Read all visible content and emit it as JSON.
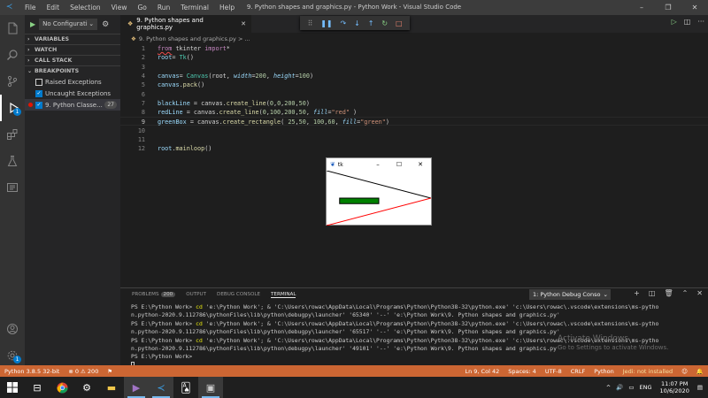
{
  "titlebar": {
    "menu": [
      "File",
      "Edit",
      "Selection",
      "View",
      "Go",
      "Run",
      "Terminal",
      "Help"
    ],
    "title": "9. Python shapes and graphics.py - Python Work - Visual Studio Code",
    "minimize": "–",
    "maximize": "❐",
    "close": "✕"
  },
  "sidebar": {
    "config_label": "No Configurati",
    "sections": [
      "VARIABLES",
      "WATCH",
      "CALL STACK",
      "BREAKPOINTS"
    ],
    "breakpoints": [
      {
        "label": "Raised Exceptions",
        "checked": false
      },
      {
        "label": "Uncaught Exceptions",
        "checked": true
      },
      {
        "label": "9. Python Classe...",
        "checked": true,
        "count": "27"
      }
    ]
  },
  "editor": {
    "tab_label": "9. Python shapes and graphics.py",
    "breadcrumb": "9. Python shapes and graphics.py > ...",
    "lines": [
      {
        "n": "1",
        "segs": [
          [
            "k squig",
            "from"
          ],
          [
            "d",
            " "
          ],
          [
            "d",
            "tkinter "
          ],
          [
            "k",
            "import"
          ],
          [
            "d",
            "*"
          ]
        ]
      },
      {
        "n": "2",
        "segs": [
          [
            "v",
            "root"
          ],
          [
            "d",
            "= "
          ],
          [
            "c",
            "Tk"
          ],
          [
            "d",
            "()"
          ]
        ]
      },
      {
        "n": "3",
        "segs": []
      },
      {
        "n": "4",
        "segs": [
          [
            "v",
            "canvas"
          ],
          [
            "d",
            "= "
          ],
          [
            "c",
            "Canvas"
          ],
          [
            "d",
            "(root, "
          ],
          [
            "p",
            "width"
          ],
          [
            "d",
            "="
          ],
          [
            "n",
            "200"
          ],
          [
            "d",
            ", "
          ],
          [
            "p",
            "height"
          ],
          [
            "d",
            "="
          ],
          [
            "n",
            "100"
          ],
          [
            "d",
            ")"
          ]
        ]
      },
      {
        "n": "5",
        "segs": [
          [
            "v",
            "canvas"
          ],
          [
            "d",
            "."
          ],
          [
            "f",
            "pack"
          ],
          [
            "d",
            "()"
          ]
        ]
      },
      {
        "n": "6",
        "segs": []
      },
      {
        "n": "7",
        "segs": [
          [
            "v",
            "blackLine"
          ],
          [
            "d",
            " = canvas."
          ],
          [
            "f",
            "create_line"
          ],
          [
            "d",
            "("
          ],
          [
            "n",
            "0"
          ],
          [
            "d",
            ","
          ],
          [
            "n",
            "0"
          ],
          [
            "d",
            ","
          ],
          [
            "n",
            "200"
          ],
          [
            "d",
            ","
          ],
          [
            "n",
            "50"
          ],
          [
            "d",
            ")"
          ]
        ]
      },
      {
        "n": "8",
        "segs": [
          [
            "v",
            "redLine"
          ],
          [
            "d",
            " = canvas."
          ],
          [
            "f",
            "create_line"
          ],
          [
            "d",
            "("
          ],
          [
            "n",
            "0"
          ],
          [
            "d",
            ","
          ],
          [
            "n",
            "100"
          ],
          [
            "d",
            ","
          ],
          [
            "n",
            "200"
          ],
          [
            "d",
            ","
          ],
          [
            "n",
            "50"
          ],
          [
            "d",
            ", "
          ],
          [
            "p",
            "fill"
          ],
          [
            "d",
            "="
          ],
          [
            "s",
            "\"red\""
          ],
          [
            "d",
            " )"
          ]
        ]
      },
      {
        "n": "9",
        "segs": [
          [
            "v",
            "greenBox"
          ],
          [
            "d",
            " = canvas."
          ],
          [
            "f",
            "create_rectangle"
          ],
          [
            "d",
            "( "
          ],
          [
            "n",
            "25"
          ],
          [
            "d",
            ","
          ],
          [
            "n",
            "50"
          ],
          [
            "d",
            ", "
          ],
          [
            "n",
            "100"
          ],
          [
            "d",
            ","
          ],
          [
            "n",
            "60"
          ],
          [
            "d",
            ", "
          ],
          [
            "p",
            "fill"
          ],
          [
            "d",
            "="
          ],
          [
            "s",
            "\"green\""
          ],
          [
            "d",
            ")"
          ]
        ]
      },
      {
        "n": "10",
        "segs": []
      },
      {
        "n": "11",
        "segs": []
      },
      {
        "n": "12",
        "segs": [
          [
            "v",
            "root"
          ],
          [
            "d",
            "."
          ],
          [
            "f",
            "mainloop"
          ],
          [
            "d",
            "()"
          ]
        ]
      }
    ]
  },
  "tk_window": {
    "title": "tk",
    "minimize": "–",
    "maximize": "☐",
    "close": "✕",
    "canvas": {
      "black_line": [
        0,
        0,
        200,
        50
      ],
      "red_line": [
        0,
        100,
        200,
        50
      ],
      "green_box": [
        25,
        50,
        100,
        60
      ],
      "size": [
        200,
        100
      ]
    }
  },
  "panel": {
    "tabs": [
      "PROBLEMS",
      "OUTPUT",
      "DEBUG CONSOLE",
      "TERMINAL"
    ],
    "problems_count": "200",
    "terminal_select": "1: Python Debug Conso",
    "terminal_lines": [
      {
        "ps": "PS E:\\Python Work> ",
        "cmd": "cd",
        "rest": " 'e:\\Python Work'; & 'C:\\Users\\rowac\\AppData\\Local\\Programs\\Python\\Python38-32\\python.exe' 'c:\\Users\\rowac\\.vscode\\extensions\\ms-pytho"
      },
      {
        "ps": "",
        "cmd": "",
        "rest": "n.python-2020.9.112786\\pythonFiles\\lib\\python\\debugpy\\launcher' '65340' '--' 'e:\\Python Work\\9. Python shapes and graphics.py'"
      },
      {
        "ps": "PS E:\\Python Work> ",
        "cmd": "cd",
        "rest": " 'e:\\Python Work'; & 'C:\\Users\\rowac\\AppData\\Local\\Programs\\Python\\Python38-32\\python.exe' 'c:\\Users\\rowac\\.vscode\\extensions\\ms-pytho"
      },
      {
        "ps": "",
        "cmd": "",
        "rest": "n.python-2020.9.112786\\pythonFiles\\lib\\python\\debugpy\\launcher' '65517' '--' 'e:\\Python Work\\9. Python shapes and graphics.py'"
      },
      {
        "ps": "PS E:\\Python Work> ",
        "cmd": "cd",
        "rest": " 'e:\\Python Work'; & 'C:\\Users\\rowac\\AppData\\Local\\Programs\\Python\\Python38-32\\python.exe' 'c:\\Users\\rowac\\.vscode\\extensions\\ms-pytho"
      },
      {
        "ps": "",
        "cmd": "",
        "rest": "n.python-2020.9.112786\\pythonFiles\\lib\\python\\debugpy\\launcher' '49101' '--' 'e:\\Python Work\\9. Python shapes and graphics.py'"
      },
      {
        "ps": "PS E:\\Python Work> ",
        "cmd": "",
        "rest": ""
      }
    ],
    "watermark_line1": "Activate Windows",
    "watermark_line2": "Go to Settings to activate Windows."
  },
  "statusbar": {
    "python": "Python 3.8.5 32-bit",
    "errors": "⊗ 0 ⚠ 200",
    "position": "Ln 9, Col 42",
    "spaces": "Spaces: 4",
    "encoding": "UTF-8",
    "eol": "CRLF",
    "language": "Python",
    "lint": "Jedi: not installed",
    "colors": {
      "bar": "#cc6633"
    }
  },
  "taskbar": {
    "lang": "ENG",
    "time": "11:07 PM",
    "date": "10/6/2020",
    "notifications": "1"
  }
}
